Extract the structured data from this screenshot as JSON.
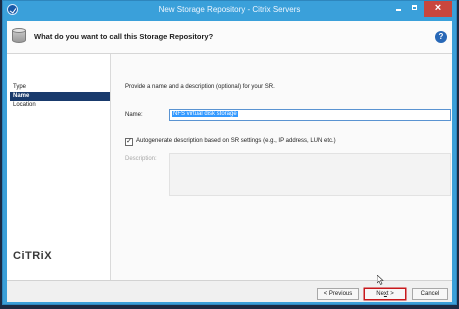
{
  "window": {
    "title": "New Storage Repository - Citrix Servers",
    "close_glyph": "×"
  },
  "header": {
    "question": "What do you want to call this Storage Repository?",
    "help_glyph": "?"
  },
  "nav": {
    "items": [
      {
        "label": "Type",
        "active": false
      },
      {
        "label": "Name",
        "active": true
      },
      {
        "label": "Location",
        "active": false
      }
    ],
    "logo": "citrix"
  },
  "form": {
    "intro": "Provide a name and a description (optional) for your SR.",
    "name_label": "Name:",
    "name_value": "NFS virtual disk storage",
    "autogenerate_checked": true,
    "check_glyph": "✓",
    "autogenerate_label": "Autogenerate description based on SR settings (e.g., IP address, LUN etc.)",
    "description_label": "Description:",
    "description_value": ""
  },
  "footer": {
    "previous_label": "< Previous",
    "next_prefix": "Ne",
    "next_underlined": "x",
    "next_suffix": "t >",
    "cancel_label": "Cancel"
  },
  "colors": {
    "titlebar": "#3aa0da",
    "active_nav": "#193a6c",
    "close_button": "#c9463d",
    "next_highlight": "#c8191c"
  }
}
